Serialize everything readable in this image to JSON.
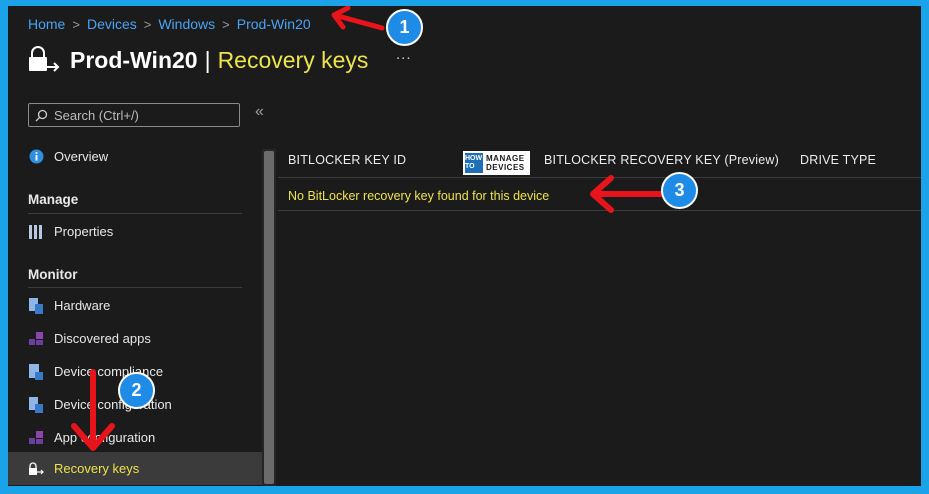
{
  "breadcrumb": {
    "items": [
      "Home",
      "Devices",
      "Windows",
      "Prod-Win20"
    ],
    "separator": ">"
  },
  "header": {
    "device": "Prod-Win20",
    "divider": "|",
    "section": "Recovery keys",
    "more": "..."
  },
  "search": {
    "placeholder": "Search (Ctrl+/)"
  },
  "collapse": "«",
  "sidebar": {
    "overview": "Overview",
    "manage_header": "Manage",
    "properties": "Properties",
    "monitor_header": "Monitor",
    "hardware": "Hardware",
    "discovered_apps": "Discovered apps",
    "device_compliance": "Device compliance",
    "device_configuration": "Device configuration",
    "app_configuration": "App configuration",
    "recovery_keys": "Recovery keys"
  },
  "table": {
    "columns": [
      "BITLOCKER KEY ID",
      "BITLOCKER RECOVERY KEY (Preview)",
      "DRIVE TYPE"
    ],
    "empty_message": "No BitLocker recovery key found for this device"
  },
  "watermark": {
    "how_to": "HOW TO",
    "manage": "MANAGE",
    "devices": "DEVICES"
  },
  "annotations": {
    "badge_1": "1",
    "badge_2": "2",
    "badge_3": "3"
  },
  "colors": {
    "accent_yellow": "#ede34a",
    "link_blue": "#4aa3f5",
    "frame_blue": "#1aa3e8",
    "badge_blue": "#1e8ce6",
    "arrow_red": "#e8141b",
    "background": "#1b1b1b"
  },
  "icons": {
    "header": "lock-arrow-icon",
    "search": "search-icon",
    "overview": "info-icon",
    "properties": "properties-bars-icon",
    "hardware": "hardware-icon",
    "discovered_apps": "apps-grid-icon",
    "device_compliance": "compliance-icon",
    "device_configuration": "configuration-icon",
    "app_configuration": "app-config-icon",
    "recovery_keys": "lock-arrow-icon"
  }
}
